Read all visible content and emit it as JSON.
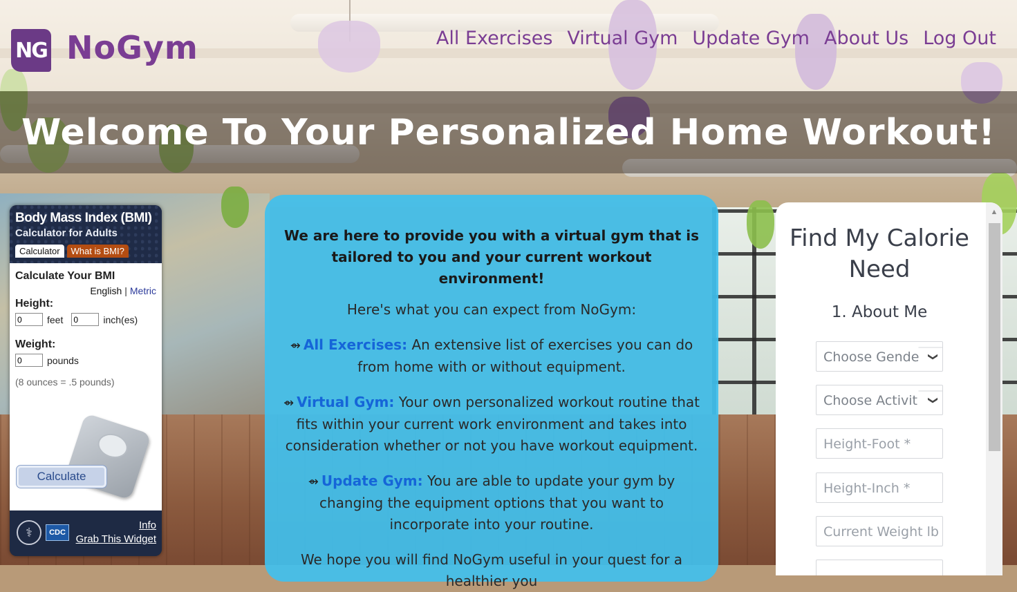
{
  "brand": {
    "badge": "NG",
    "name": "NoGym",
    "color": "#7a3d93"
  },
  "nav": {
    "items": [
      "All Exercises",
      "Virtual Gym",
      "Update Gym",
      "About Us",
      "Log Out"
    ]
  },
  "hero": {
    "title": "Welcome To Your Personalized Home Workout!"
  },
  "bmi_widget": {
    "title": "Body Mass Index (BMI)",
    "subtitle": "Calculator for Adults",
    "tabs": [
      "Calculator",
      "What is BMI?"
    ],
    "heading": "Calculate Your BMI",
    "units": {
      "english": "English",
      "separator": "|",
      "metric": "Metric"
    },
    "height_label": "Height:",
    "height_feet_value": "0",
    "feet_unit": "feet",
    "height_inch_value": "0",
    "inch_unit": "inch(es)",
    "weight_label": "Weight:",
    "weight_value": "0",
    "weight_unit": "pounds",
    "note": "(8 ounces = .5 pounds)",
    "calculate": "Calculate",
    "footer": {
      "cdc": "CDC",
      "info": "Info",
      "grab": "Grab This Widget"
    }
  },
  "intro": {
    "lead": "We are here to provide you with a virtual gym that is tailored to you and your current workout environment!",
    "expect": "Here's what you can expect from NoGym:",
    "arrow": "⇴",
    "features": [
      {
        "name": "All Exercises:",
        "text": "An extensive list of exercises you can do from home with or without equipment."
      },
      {
        "name": "Virtual Gym:",
        "text": "Your own personalized workout routine that fits within your current work environment and takes into consideration whether or not you have workout equipment."
      },
      {
        "name": "Update Gym:",
        "text": "You are able to update your gym by changing the equipment options that you want to incorporate into your routine."
      }
    ],
    "closing": "We hope you will find NoGym useful in your quest for a healthier you"
  },
  "calorie": {
    "title": "Find My Calorie Need",
    "step": "1. About Me",
    "gender_placeholder": "Choose Gende",
    "activity_placeholder": "Choose Activit",
    "height_foot_placeholder": "Height-Foot *",
    "height_inch_placeholder": "Height-Inch *",
    "weight_placeholder": "Current Weight lb *"
  }
}
